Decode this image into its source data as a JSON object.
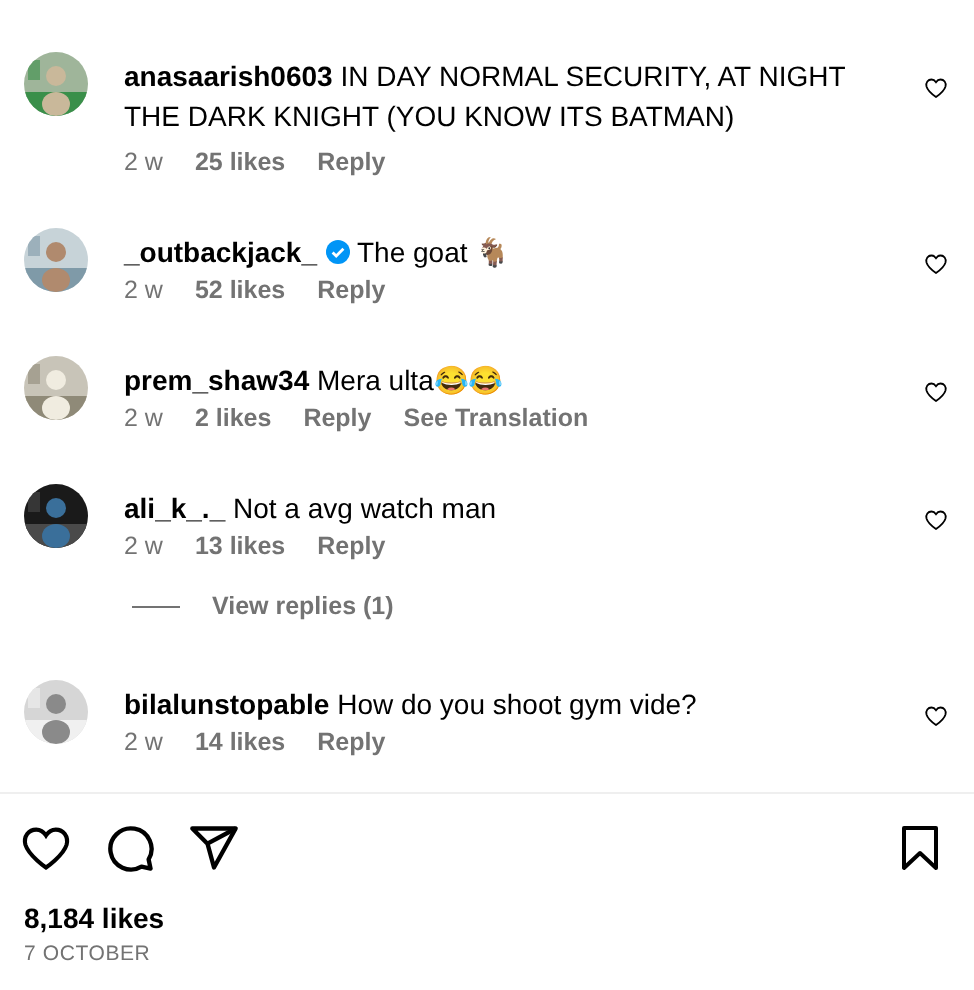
{
  "comments": [
    {
      "username": "anasaarish0603",
      "verified": false,
      "text": "IN DAY NORMAL SECURITY, AT NIGHT THE DARK KNIGHT (YOU KNOW ITS BATMAN)",
      "time": "2 w",
      "likes": "25 likes",
      "reply": "Reply"
    },
    {
      "username": "_outbackjack_",
      "verified": true,
      "text": "The goat 🐐",
      "time": "2 w",
      "likes": "52 likes",
      "reply": "Reply"
    },
    {
      "username": "prem_shaw34",
      "verified": false,
      "text": "Mera ulta😂😂",
      "time": "2 w",
      "likes": "2 likes",
      "reply": "Reply",
      "translation": "See Translation"
    },
    {
      "username": "ali_k_._",
      "verified": false,
      "text": "Not a avg watch man",
      "time": "2 w",
      "likes": "13 likes",
      "reply": "Reply",
      "view_replies": "View replies (1)"
    },
    {
      "username": "bilalunstopable",
      "verified": false,
      "text": "How do you shoot gym vide?",
      "time": "2 w",
      "likes": "14 likes",
      "reply": "Reply"
    }
  ],
  "post": {
    "likes": "8,184 likes",
    "date": "7 OCTOBER"
  }
}
